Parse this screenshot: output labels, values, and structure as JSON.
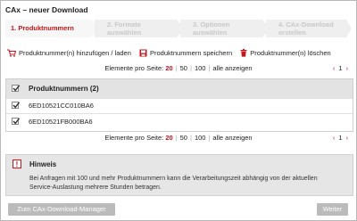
{
  "window": {
    "title": "CAx – neuer Download"
  },
  "wizard": {
    "steps": [
      {
        "label": "1. Produktnummern"
      },
      {
        "label_line1": "2. Formate",
        "label_line2": "auswählen"
      },
      {
        "label_line1": "3. Optionen",
        "label_line2": "auswählen"
      },
      {
        "label_line1": "4. CAx-Download",
        "label_line2": "erstellen"
      }
    ],
    "active_step": 1,
    "active_color": "#c4161c",
    "inactive_color": "#c8c8c8"
  },
  "actions": {
    "add_load": "Produktnummer(n) hinzufügen / laden",
    "save": "Produktnummern speichern",
    "delete": "Produktnummer(n) löschen"
  },
  "pager": {
    "label": "Elemente pro Seite:",
    "options": [
      "20",
      "50",
      "100"
    ],
    "selected": "20",
    "show_all": "alle anzeigen",
    "prev": "‹",
    "page": "1",
    "next": "›"
  },
  "table": {
    "header": "Produktnummern (2)",
    "rows": [
      "6ED10521CC010BA6",
      "6ED10521FB000BA6"
    ],
    "checked": true
  },
  "info": {
    "icon": "!",
    "title": "Hinweis",
    "text": "Bei Anfragen mit 100 und mehr Produktnummern kann die Verarbeitungszeit abhängig von der aktuellen Service-Auslastung mehrere Stunden betragen."
  },
  "buttons": {
    "manager": "Zum CAx-Download-Manager",
    "next": "Weiter"
  },
  "colors": {
    "accent": "#c4161c",
    "button_disabled": "#bbbbbb"
  }
}
